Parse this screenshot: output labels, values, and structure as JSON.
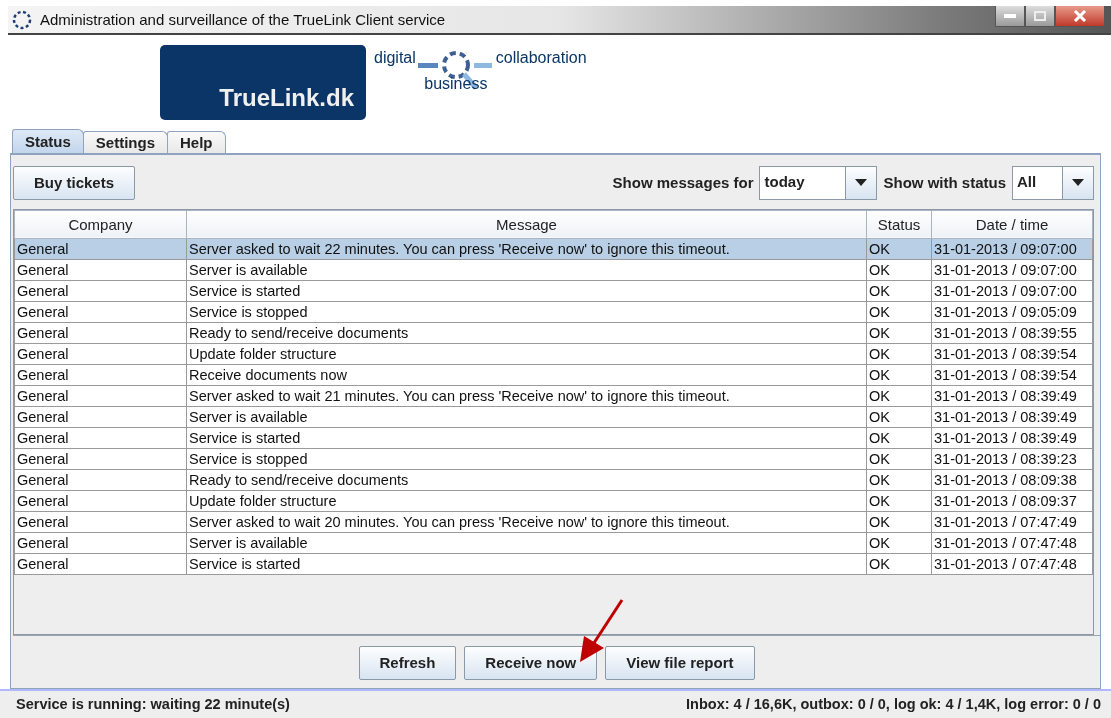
{
  "window": {
    "title": "Administration and surveillance of the TrueLink Client service"
  },
  "logo": {
    "name": "TrueLink.dk",
    "tagline_left": "digital",
    "tagline_right": "collaboration",
    "tagline_bottom": "business"
  },
  "tabs": [
    {
      "label": "Status",
      "selected": true
    },
    {
      "label": "Settings",
      "selected": false
    },
    {
      "label": "Help",
      "selected": false
    }
  ],
  "toolbar": {
    "buy_button": "Buy tickets",
    "messages_label": "Show messages for",
    "messages_value": "today",
    "status_label": "Show with status",
    "status_value": "All"
  },
  "table": {
    "columns": [
      "Company",
      "Message",
      "Status",
      "Date / time"
    ],
    "rows": [
      {
        "company": "General",
        "message": "Server asked to wait 22 minutes. You can press 'Receive now' to ignore this timeout.",
        "status": "OK",
        "datetime": "31-01-2013 / 09:07:00",
        "selected": true
      },
      {
        "company": "General",
        "message": "Server is available",
        "status": "OK",
        "datetime": "31-01-2013 / 09:07:00",
        "selected": false
      },
      {
        "company": "General",
        "message": "Service is started",
        "status": "OK",
        "datetime": "31-01-2013 / 09:07:00",
        "selected": false
      },
      {
        "company": "General",
        "message": "Service is stopped",
        "status": "OK",
        "datetime": "31-01-2013 / 09:05:09",
        "selected": false
      },
      {
        "company": "General",
        "message": "Ready to send/receive documents",
        "status": "OK",
        "datetime": "31-01-2013 / 08:39:55",
        "selected": false
      },
      {
        "company": "General",
        "message": "Update folder structure",
        "status": "OK",
        "datetime": "31-01-2013 / 08:39:54",
        "selected": false
      },
      {
        "company": "General",
        "message": "Receive documents now",
        "status": "OK",
        "datetime": "31-01-2013 / 08:39:54",
        "selected": false
      },
      {
        "company": "General",
        "message": "Server asked to wait 21 minutes. You can press 'Receive now' to ignore this timeout.",
        "status": "OK",
        "datetime": "31-01-2013 / 08:39:49",
        "selected": false
      },
      {
        "company": "General",
        "message": "Server is available",
        "status": "OK",
        "datetime": "31-01-2013 / 08:39:49",
        "selected": false
      },
      {
        "company": "General",
        "message": "Service is started",
        "status": "OK",
        "datetime": "31-01-2013 / 08:39:49",
        "selected": false
      },
      {
        "company": "General",
        "message": "Service is stopped",
        "status": "OK",
        "datetime": "31-01-2013 / 08:39:23",
        "selected": false
      },
      {
        "company": "General",
        "message": "Ready to send/receive documents",
        "status": "OK",
        "datetime": "31-01-2013 / 08:09:38",
        "selected": false
      },
      {
        "company": "General",
        "message": "Update folder structure",
        "status": "OK",
        "datetime": "31-01-2013 / 08:09:37",
        "selected": false
      },
      {
        "company": "General",
        "message": "Server asked to wait 20 minutes. You can press 'Receive now' to ignore this timeout.",
        "status": "OK",
        "datetime": "31-01-2013 / 07:47:49",
        "selected": false
      },
      {
        "company": "General",
        "message": "Server is available",
        "status": "OK",
        "datetime": "31-01-2013 / 07:47:48",
        "selected": false
      },
      {
        "company": "General",
        "message": "Service is started",
        "status": "OK",
        "datetime": "31-01-2013 / 07:47:48",
        "selected": false
      }
    ]
  },
  "buttons": [
    "Refresh",
    "Receive now",
    "View file report"
  ],
  "status_bar": {
    "left": "Service is running: waiting 22 minute(s)",
    "right": "Inbox: 4 / 16,6K, outbox: 0 / 0, log ok: 4 / 1,4K, log error: 0 / 0"
  }
}
